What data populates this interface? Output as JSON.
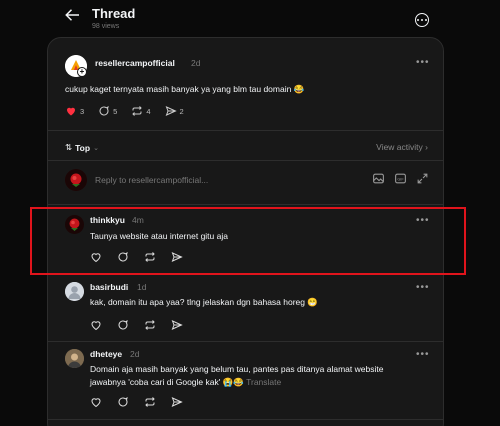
{
  "header": {
    "title": "Thread",
    "views": "98 views"
  },
  "post": {
    "username": "resellercampofficial",
    "time": "2d",
    "text": "cukup kaget ternyata masih banyak ya yang blm tau domain 😂",
    "likes": "3",
    "replies": "5",
    "reposts": "4",
    "shares": "2"
  },
  "sort": {
    "label": "Top",
    "view_activity": "View activity"
  },
  "reply_box": {
    "placeholder": "Reply to resellercampofficial..."
  },
  "comments": [
    {
      "username": "thinkkyu",
      "time": "4m",
      "text": "Taunya website atau internet gitu aja",
      "translate": ""
    },
    {
      "username": "basirbudi",
      "time": "1d",
      "text": "kak, domain itu apa yaa? tlng jelaskan dgn bahasa horeg 😁",
      "translate": ""
    },
    {
      "username": "dheteye",
      "time": "2d",
      "text_line1": "Domain aja masih banyak yang belum tau, pantes pas ditanya alamat website",
      "text_line2": "jawabnya 'coba cari di Google kak' 😭😂",
      "translate": "Translate"
    }
  ],
  "colors": {
    "background": "#0a0a0a",
    "card": "#181818",
    "like_red": "#ff3040",
    "highlight_box": "#e0141c"
  }
}
